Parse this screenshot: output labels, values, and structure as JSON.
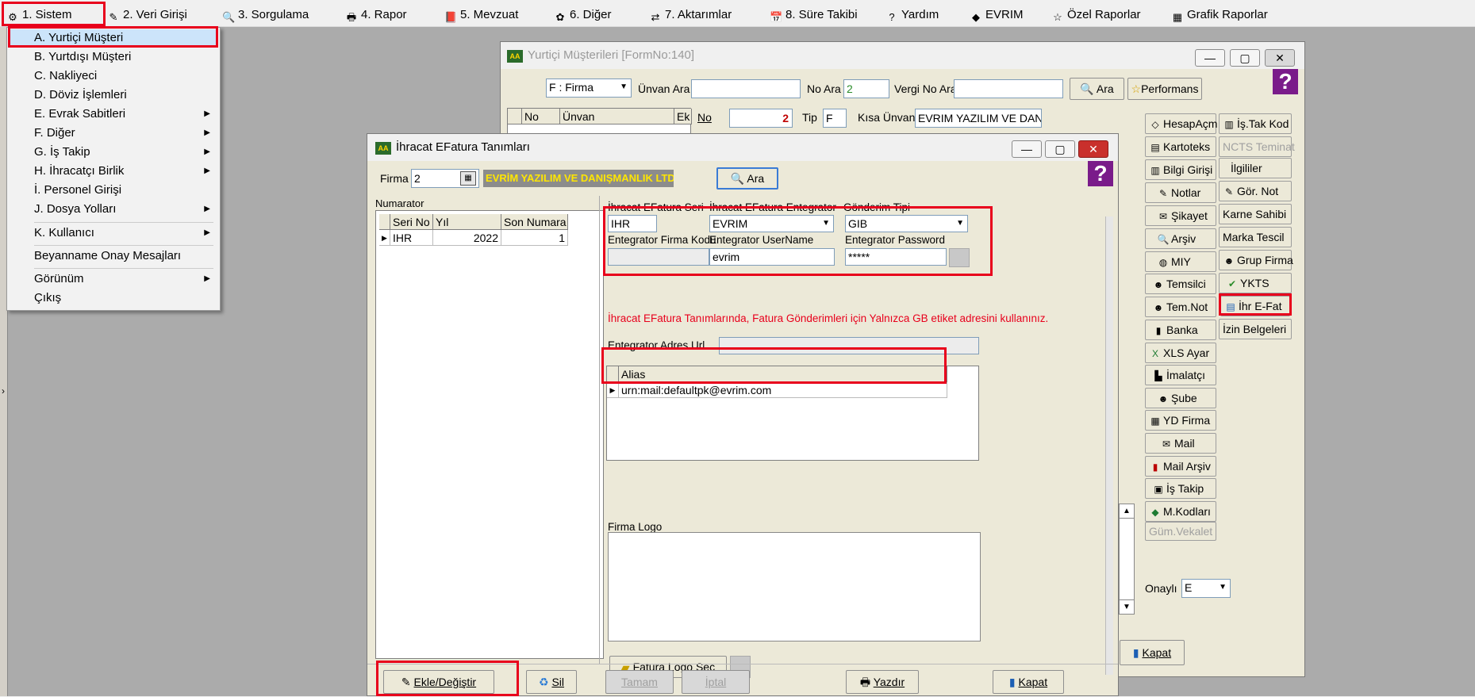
{
  "menubar": {
    "items": [
      {
        "label": "1.  Sistem",
        "icon": "settings-icon"
      },
      {
        "label": "2.  Veri Girişi",
        "icon": "data-entry-icon"
      },
      {
        "label": "3.  Sorgulama",
        "icon": "query-icon"
      },
      {
        "label": "4.  Rapor",
        "icon": "printer-icon"
      },
      {
        "label": "5.  Mevzuat",
        "icon": "book-icon"
      },
      {
        "label": "6.  Diğer",
        "icon": "other-icon"
      },
      {
        "label": "7.  Aktarımlar",
        "icon": "transfer-icon"
      },
      {
        "label": "8. Süre Takibi",
        "icon": "calendar-icon"
      },
      {
        "label": "Yardım",
        "icon": "help-icon"
      },
      {
        "label": "EVRIM",
        "icon": "evrim-icon"
      },
      {
        "label": "Özel Raporlar",
        "icon": "star-icon"
      },
      {
        "label": "Grafik Raporlar",
        "icon": "chart-icon"
      }
    ]
  },
  "dropdown": {
    "items": [
      {
        "label": "A.  Yurtiçi Müşteri",
        "submenu": false
      },
      {
        "label": "B.  Yurtdışı Müşteri",
        "submenu": false
      },
      {
        "label": "C.  Nakliyeci",
        "submenu": false
      },
      {
        "label": "D.  Döviz İşlemleri",
        "submenu": false
      },
      {
        "label": "E.  Evrak Sabitleri",
        "submenu": true
      },
      {
        "label": "F.  Diğer",
        "submenu": true
      },
      {
        "label": "G.  İş Takip",
        "submenu": true
      },
      {
        "label": "H.  İhracatçı Birlik",
        "submenu": true
      },
      {
        "label": "İ.   Personel Girişi",
        "submenu": false
      },
      {
        "label": "J.  Dosya Yolları",
        "submenu": true
      },
      {
        "label": "K.  Kullanıcı",
        "submenu": true
      },
      {
        "label": "Beyanname Onay Mesajları",
        "submenu": false
      },
      {
        "label": "Görünüm",
        "submenu": true
      },
      {
        "label": "Çıkış",
        "submenu": false
      }
    ]
  },
  "musteri_window": {
    "title": "Yurtiçi Müşterileri [FormNo:140]",
    "filter_select": "F : Firma",
    "unvan_ara_label": "Ünvan Ara",
    "unvan_ara_value": "",
    "no_ara_label": "No Ara",
    "no_ara_value": "2",
    "vergi_no_ara_label": "Vergi No Ara",
    "vergi_no_ara_value": "",
    "ara_label": "Ara",
    "performans_label": "Performans",
    "grid_headers": [
      "No",
      "Ünvan",
      "Ek"
    ],
    "no_label": "No",
    "no_value": "2",
    "tip_label": "Tip",
    "tip_value": "F",
    "kisa_unvan_label": "Kısa Ünvanı",
    "kisa_unvan_value": "EVRIM YAZILIM VE DAN",
    "side_buttons_left": [
      "HesapAçm",
      "Kartoteks",
      "Bilgi Girişi",
      "Notlar",
      "Şikayet",
      "Arşiv",
      "MIY",
      "Temsilci",
      "Tem.Not",
      "Banka",
      "XLS Ayar",
      "İmalatçı",
      "Şube",
      "YD Firma",
      "Mail",
      "Mail Arşiv",
      "İş Takip",
      "M.Kodları",
      "Güm.Vekalet"
    ],
    "side_buttons_right": [
      "İş.Tak Kod",
      "NCTS Teminat",
      "İlgililer",
      "Gör. Not",
      "Karne Sahibi",
      "Marka Tescil",
      "Grup Firma",
      "YKTS",
      "İhr E-Fat",
      "İzin Belgeleri"
    ],
    "onayli_label": "Onaylı",
    "onayli_value": "E",
    "kapat_label": "Kapat"
  },
  "efatura_window": {
    "title": "İhracat EFatura Tanımları",
    "firma_label": "Firma",
    "firma_value": "2",
    "firma_name": "EVRİM YAZILIM VE DANIŞMANLIK LTD ŞT",
    "ara_label": "Ara",
    "numarator_label": "Numarator",
    "num_headers": [
      "Seri No",
      "Yıl",
      "Son Numara"
    ],
    "num_rows": [
      [
        "IHR",
        "2022",
        "1"
      ]
    ],
    "seri_label": "İhracat EFatura Seri",
    "seri_value": "IHR",
    "entegrator_label": "İhracat EFatura Entegrator",
    "entegrator_value": "EVRIM",
    "gonderim_label": "Gönderim Tipi",
    "gonderim_value": "GIB",
    "firma_kodu_label": "Entegrator Firma Kodu",
    "firma_kodu_value": "",
    "username_label": "Entegrator UserName",
    "username_value": "evrim",
    "password_label": "Entegrator Password",
    "password_value": "*****",
    "warning": "İhracat EFatura Tanımlarında, Fatura Gönderimleri için Yalnızca GB etiket adresini kullanınız.",
    "adres_url_label": "Entegrator Adres Url",
    "adres_url_value": "",
    "alias_header": "Alias",
    "alias_rows": [
      "urn:mail:defaultpk@evrim.com"
    ],
    "logo_label": "Firma Logo",
    "logo_sec_label": "Fatura Logo Seç",
    "ekle_label": "Ekle/Değiştir",
    "sil_label": "Sil",
    "tamam_label": "Tamam",
    "iptal_label": "İptal",
    "yazdir_label": "Yazdır",
    "kapat_label": "Kapat"
  },
  "colors": {
    "highlight": "#e8001c",
    "firma_name_bg": "#8c8c8c",
    "firma_name_fg": "#ffe600",
    "warning": "#e8001c"
  }
}
